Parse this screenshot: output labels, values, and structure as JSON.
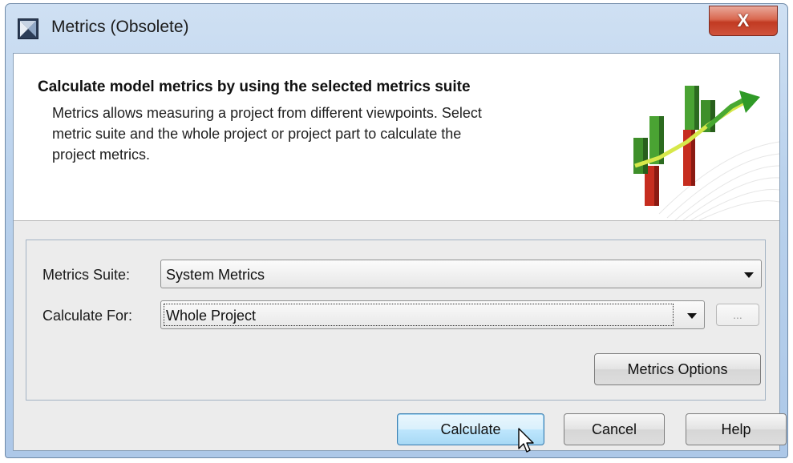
{
  "window": {
    "title": "Metrics (Obsolete)",
    "close_label": "X",
    "app_icon": "metrics-app-icon",
    "close_icon": "close-icon"
  },
  "banner": {
    "title": "Calculate model metrics by using the selected metrics suite",
    "description": "Metrics allows measuring a project from different viewpoints. Select\nmetric suite and the whole project or project part to calculate the\nproject metrics.",
    "illustration": "metrics-chart-illustration"
  },
  "form": {
    "metrics_suite": {
      "label": "Metrics Suite:",
      "value": "System Metrics"
    },
    "calculate_for": {
      "label": "Calculate For:",
      "value": "Whole Project"
    },
    "ellipsis_label": "...",
    "options_label": "Metrics Options"
  },
  "actions": {
    "calculate_label": "Calculate",
    "cancel_label": "Cancel",
    "help_label": "Help"
  },
  "colors": {
    "title_bar": "#b9d1ec",
    "close_button": "#c13a22",
    "default_button": "#bee6fd"
  }
}
